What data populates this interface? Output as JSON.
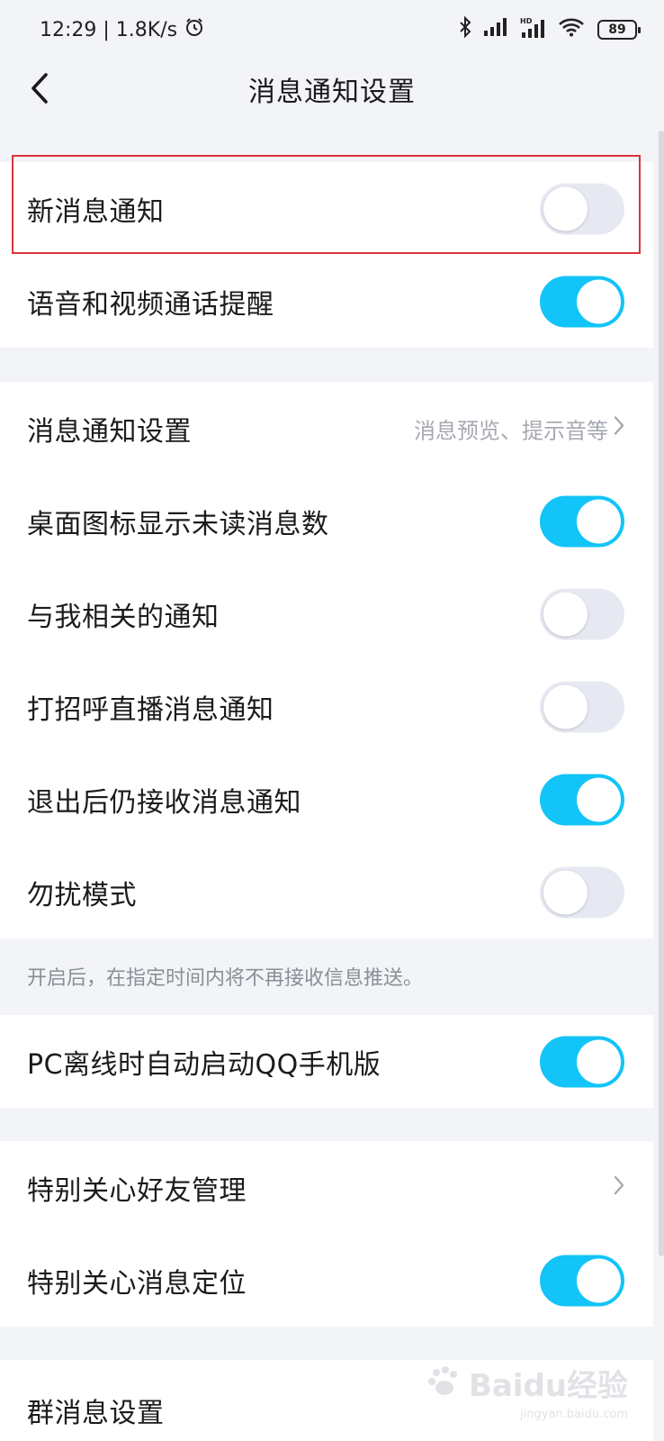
{
  "status_bar": {
    "time_speed": "12:29 | 1.8K/s",
    "battery": "89",
    "icons": [
      "alarm-icon",
      "bluetooth-icon",
      "signal-icon",
      "hd-signal-icon",
      "wifi-icon",
      "battery-icon"
    ]
  },
  "nav": {
    "back_icon": "chevron-left-icon",
    "title": "消息通知设置"
  },
  "group1": [
    {
      "label": "新消息通知",
      "toggle_on": false
    },
    {
      "label": "语音和视频通话提醒",
      "toggle_on": true
    }
  ],
  "group2": {
    "settings_row": {
      "label": "消息通知设置",
      "value": "消息预览、提示音等"
    },
    "rows": [
      {
        "label": "桌面图标显示未读消息数",
        "toggle_on": true
      },
      {
        "label": "与我相关的通知",
        "toggle_on": false
      },
      {
        "label": "打招呼直播消息通知",
        "toggle_on": false
      },
      {
        "label": "退出后仍接收消息通知",
        "toggle_on": true
      },
      {
        "label": "勿扰模式",
        "toggle_on": false
      }
    ],
    "hint": "开启后，在指定时间内将不再接收信息推送。"
  },
  "group3": [
    {
      "label": "PC离线时自动启动QQ手机版",
      "toggle_on": true
    }
  ],
  "group4": {
    "manage_row": {
      "label": "特别关心好友管理"
    },
    "locate_row": {
      "label": "特别关心消息定位",
      "toggle_on": true
    }
  },
  "group5": {
    "group_row": {
      "label": "群消息设置"
    }
  },
  "watermark": {
    "brand": "Baidu经验",
    "site": "jingyan.baidu.com"
  },
  "colors": {
    "accent": "#12c4f7",
    "toggle_off": "#e7e9f2",
    "background": "#f3f4f8",
    "highlight": "#d9343c"
  }
}
